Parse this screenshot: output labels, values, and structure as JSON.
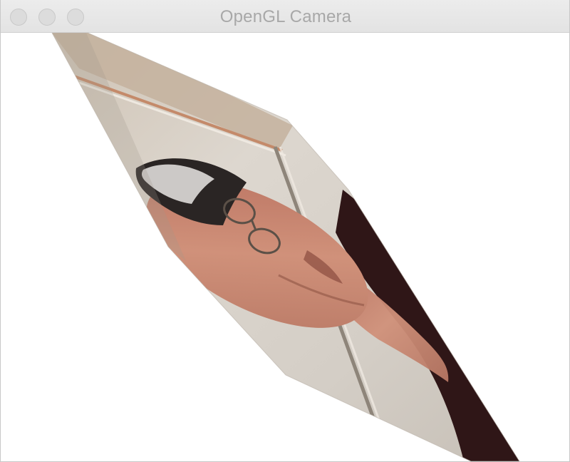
{
  "window": {
    "title": "OpenGL Camera",
    "controls": [
      "close",
      "minimize",
      "zoom"
    ]
  },
  "scene": {
    "background": "#ffffff",
    "content": "camera-feed-texture-on-rotated-quad",
    "colors": {
      "wall": "#d9d4cc",
      "wall_shadow": "#b9b2a7",
      "frame": "#c9b9a4",
      "skin": "#c98a73",
      "shirt": "#2f1617",
      "hair": "#2a2524"
    }
  }
}
